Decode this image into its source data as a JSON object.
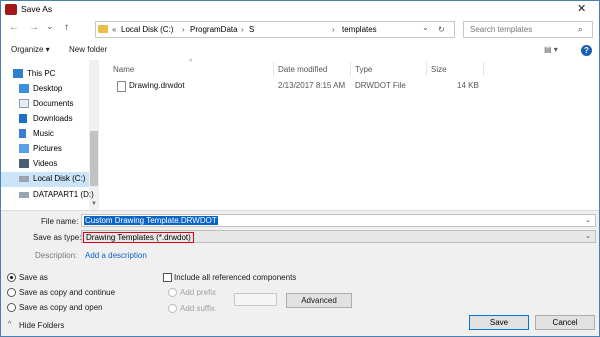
{
  "window": {
    "title": "Save As",
    "close_glyph": "✕"
  },
  "nav": {
    "back_glyph": "←",
    "forward_glyph": "→",
    "recent_glyph": "⌄",
    "up_glyph": "↑"
  },
  "address": {
    "overflow": "«",
    "crumbs": [
      "Local Disk (C:)",
      "ProgramData",
      "S",
      "templates"
    ],
    "separator": "›",
    "dropdown_glyph": "⌄",
    "refresh_glyph": "↻"
  },
  "search": {
    "placeholder": "Search templates",
    "icon_glyph": "⌕"
  },
  "toolbar": {
    "organize": "Organize ▾",
    "new_folder": "New folder",
    "view_glyph": "▤ ▾",
    "help": "?"
  },
  "sidebar": {
    "items": [
      {
        "label": "This PC",
        "icon": "pc-icon"
      },
      {
        "label": "Desktop",
        "icon": "desktop-icon"
      },
      {
        "label": "Documents",
        "icon": "documents-icon"
      },
      {
        "label": "Downloads",
        "icon": "downloads-icon"
      },
      {
        "label": "Music",
        "icon": "music-icon"
      },
      {
        "label": "Pictures",
        "icon": "pictures-icon"
      },
      {
        "label": "Videos",
        "icon": "videos-icon"
      },
      {
        "label": "Local Disk (C:)",
        "icon": "disk-icon",
        "selected": true
      },
      {
        "label": "DATAPART1 (D:)",
        "icon": "disk-icon"
      }
    ],
    "scroll_up": "▲",
    "scroll_down": "▼"
  },
  "file_list": {
    "columns": {
      "name": "Name",
      "date": "Date modified",
      "type": "Type",
      "size": "Size"
    },
    "sort_glyph": "^",
    "files": [
      {
        "name": "Drawing.drwdot",
        "date": "2/13/2017 8:15 AM",
        "type": "DRWDOT File",
        "size": "14 KB"
      }
    ]
  },
  "form": {
    "file_name_label": "File name:",
    "file_name_value": "Custom Drawing Template.DRWDOT",
    "save_type_label": "Save as type:",
    "save_type_value": "Drawing Templates (*.drwdot)",
    "description_label": "Description:",
    "description_link": "Add a description",
    "dropdown_glyph": "⌄"
  },
  "options": {
    "save_as": "Save as",
    "save_copy_continue": "Save as copy and continue",
    "save_copy_open": "Save as copy and open",
    "include_refs": "Include all referenced components",
    "add_prefix": "Add prefix",
    "add_suffix": "Add suffix",
    "advanced": "Advanced"
  },
  "footer": {
    "hide_folders": "Hide Folders",
    "hide_glyph": "^",
    "save": "Save",
    "cancel": "Cancel"
  },
  "colors": {
    "selection": "#0a64c8",
    "highlight_border": "#d9001b",
    "link": "#0b62c6",
    "sidebar_selected": "#cce4f7"
  }
}
